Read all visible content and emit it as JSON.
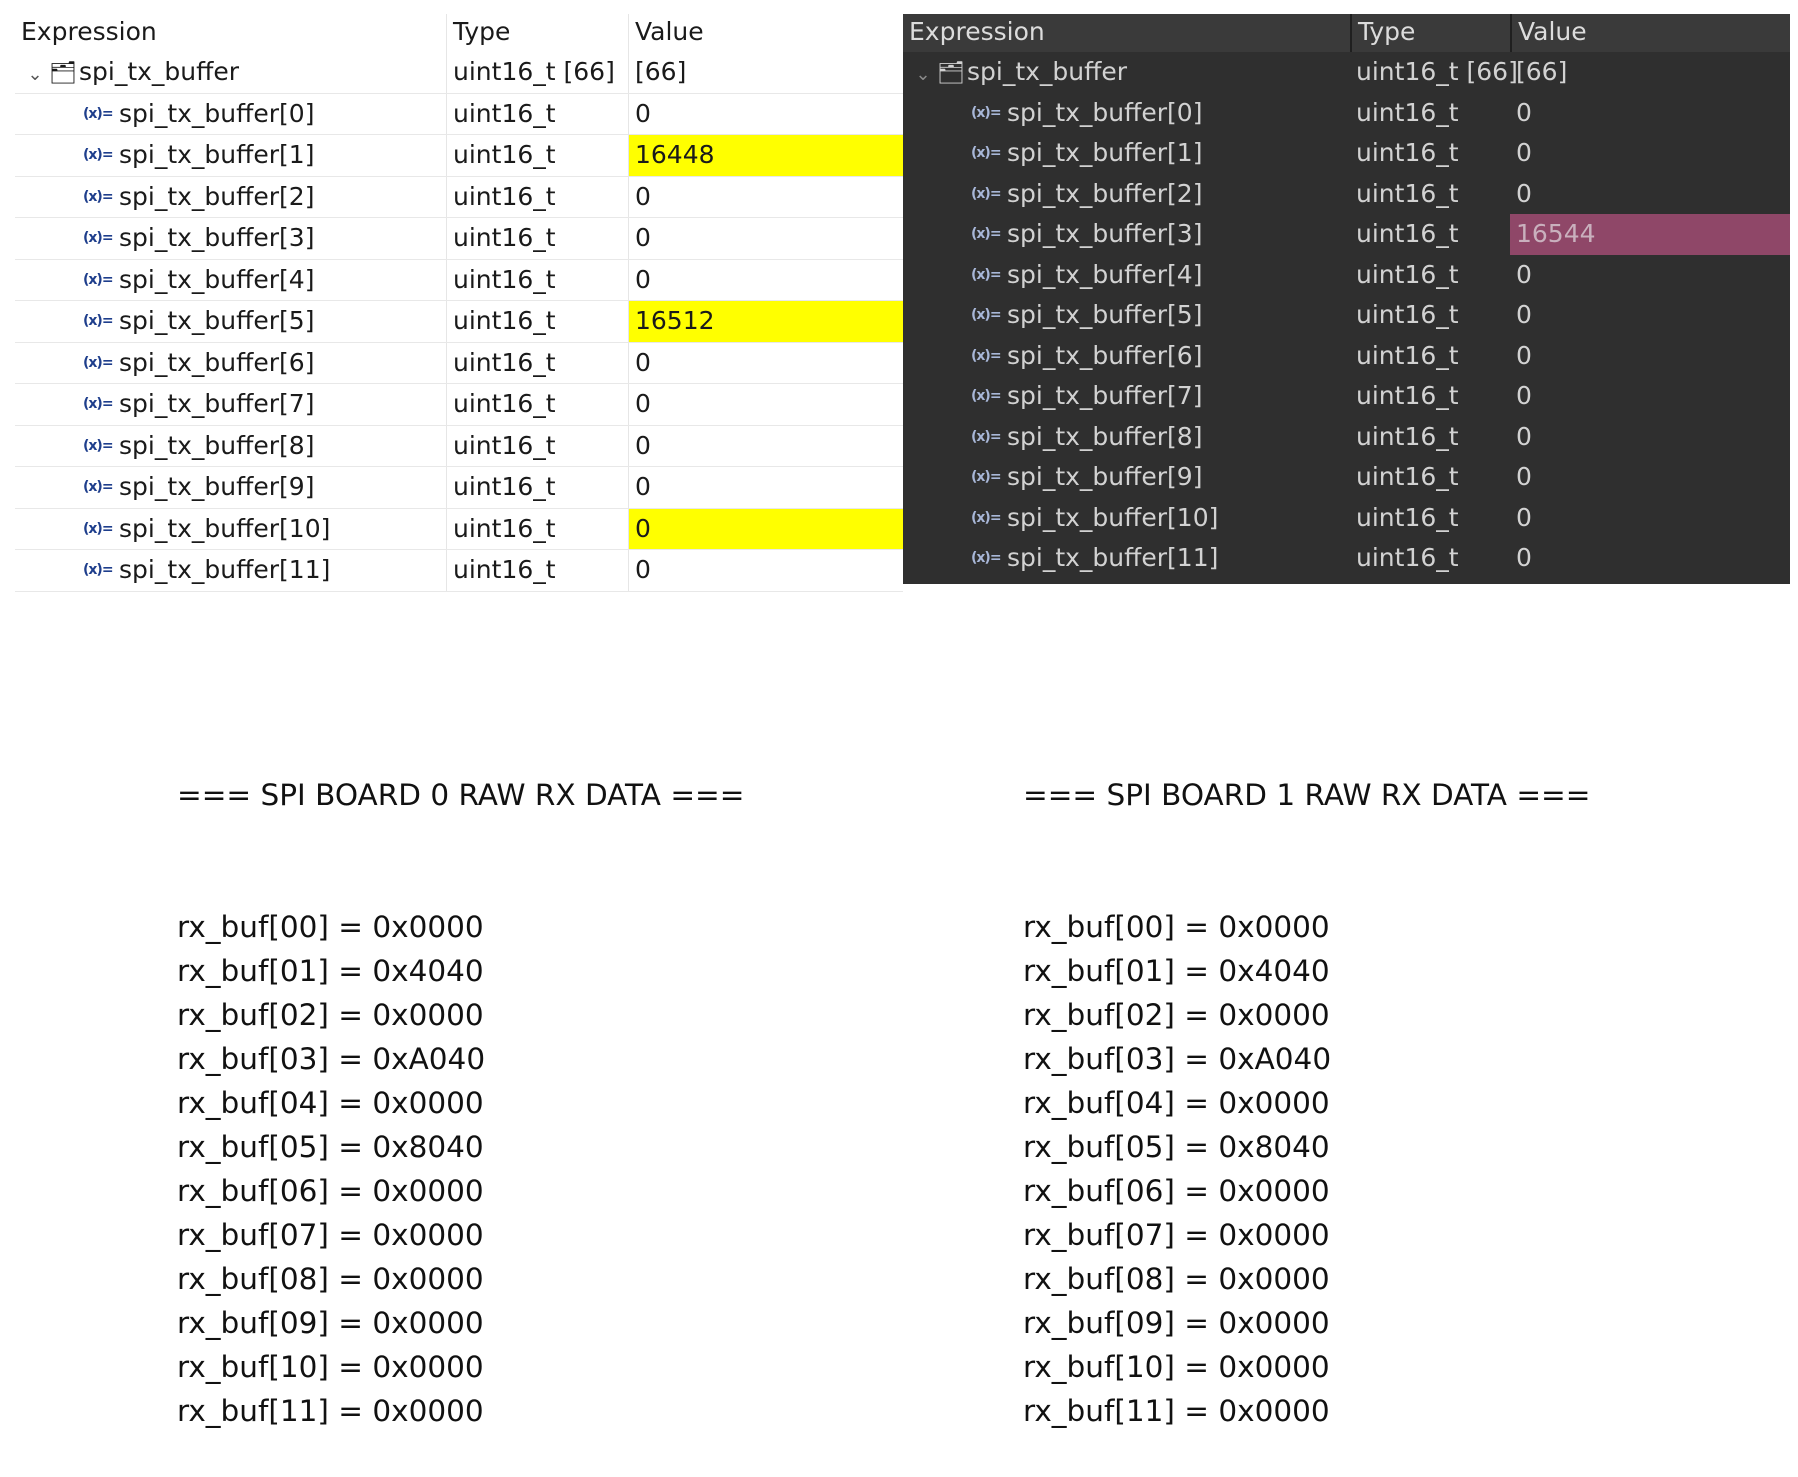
{
  "light_panel": {
    "headers": {
      "expression": "Expression",
      "type": "Type",
      "value": "Value"
    },
    "parent": {
      "name": "spi_tx_buffer",
      "type": "uint16_t [66]",
      "value": "[66]"
    },
    "rows": [
      {
        "name": "spi_tx_buffer[0]",
        "type": "uint16_t",
        "value": "0",
        "highlight": ""
      },
      {
        "name": "spi_tx_buffer[1]",
        "type": "uint16_t",
        "value": "16448",
        "highlight": "yellow"
      },
      {
        "name": "spi_tx_buffer[2]",
        "type": "uint16_t",
        "value": "0",
        "highlight": ""
      },
      {
        "name": "spi_tx_buffer[3]",
        "type": "uint16_t",
        "value": "0",
        "highlight": ""
      },
      {
        "name": "spi_tx_buffer[4]",
        "type": "uint16_t",
        "value": "0",
        "highlight": ""
      },
      {
        "name": "spi_tx_buffer[5]",
        "type": "uint16_t",
        "value": "16512",
        "highlight": "yellow"
      },
      {
        "name": "spi_tx_buffer[6]",
        "type": "uint16_t",
        "value": "0",
        "highlight": ""
      },
      {
        "name": "spi_tx_buffer[7]",
        "type": "uint16_t",
        "value": "0",
        "highlight": ""
      },
      {
        "name": "spi_tx_buffer[8]",
        "type": "uint16_t",
        "value": "0",
        "highlight": ""
      },
      {
        "name": "spi_tx_buffer[9]",
        "type": "uint16_t",
        "value": "0",
        "highlight": ""
      },
      {
        "name": "spi_tx_buffer[10]",
        "type": "uint16_t",
        "value": "0",
        "highlight": "yellow"
      },
      {
        "name": "spi_tx_buffer[11]",
        "type": "uint16_t",
        "value": "0",
        "highlight": ""
      }
    ]
  },
  "dark_panel": {
    "headers": {
      "expression": "Expression",
      "type": "Type",
      "value": "Value"
    },
    "parent": {
      "name": "spi_tx_buffer",
      "type": "uint16_t [66]",
      "value": "[66]"
    },
    "rows": [
      {
        "name": "spi_tx_buffer[0]",
        "type": "uint16_t",
        "value": "0",
        "highlight": ""
      },
      {
        "name": "spi_tx_buffer[1]",
        "type": "uint16_t",
        "value": "0",
        "highlight": ""
      },
      {
        "name": "spi_tx_buffer[2]",
        "type": "uint16_t",
        "value": "0",
        "highlight": ""
      },
      {
        "name": "spi_tx_buffer[3]",
        "type": "uint16_t",
        "value": "16544",
        "highlight": "pink"
      },
      {
        "name": "spi_tx_buffer[4]",
        "type": "uint16_t",
        "value": "0",
        "highlight": ""
      },
      {
        "name": "spi_tx_buffer[5]",
        "type": "uint16_t",
        "value": "0",
        "highlight": ""
      },
      {
        "name": "spi_tx_buffer[6]",
        "type": "uint16_t",
        "value": "0",
        "highlight": ""
      },
      {
        "name": "spi_tx_buffer[7]",
        "type": "uint16_t",
        "value": "0",
        "highlight": ""
      },
      {
        "name": "spi_tx_buffer[8]",
        "type": "uint16_t",
        "value": "0",
        "highlight": ""
      },
      {
        "name": "spi_tx_buffer[9]",
        "type": "uint16_t",
        "value": "0",
        "highlight": ""
      },
      {
        "name": "spi_tx_buffer[10]",
        "type": "uint16_t",
        "value": "0",
        "highlight": ""
      },
      {
        "name": "spi_tx_buffer[11]",
        "type": "uint16_t",
        "value": "0",
        "highlight": ""
      }
    ]
  },
  "icons": {
    "expand": "chevron-down-icon",
    "parent": "folder-variable-icon",
    "child": "variable-icon",
    "child_glyph": "(x)="
  },
  "colors": {
    "highlight_yellow": "#ffff00",
    "highlight_pink": "#8f4768",
    "dark_bg": "#2f2f2f"
  },
  "rx_board0": {
    "title": "=== SPI BOARD 0 RAW RX DATA ===",
    "lines": [
      "rx_buf[00] = 0x0000",
      "rx_buf[01] = 0x4040",
      "rx_buf[02] = 0x0000",
      "rx_buf[03] = 0xA040",
      "rx_buf[04] = 0x0000",
      "rx_buf[05] = 0x8040",
      "rx_buf[06] = 0x0000",
      "rx_buf[07] = 0x0000",
      "rx_buf[08] = 0x0000",
      "rx_buf[09] = 0x0000",
      "rx_buf[10] = 0x0000",
      "rx_buf[11] = 0x0000"
    ]
  },
  "rx_board1": {
    "title": "=== SPI BOARD 1 RAW RX DATA ===",
    "lines": [
      "rx_buf[00] = 0x0000",
      "rx_buf[01] = 0x4040",
      "rx_buf[02] = 0x0000",
      "rx_buf[03] = 0xA040",
      "rx_buf[04] = 0x0000",
      "rx_buf[05] = 0x8040",
      "rx_buf[06] = 0x0000",
      "rx_buf[07] = 0x0000",
      "rx_buf[08] = 0x0000",
      "rx_buf[09] = 0x0000",
      "rx_buf[10] = 0x0000",
      "rx_buf[11] = 0x0000"
    ]
  }
}
